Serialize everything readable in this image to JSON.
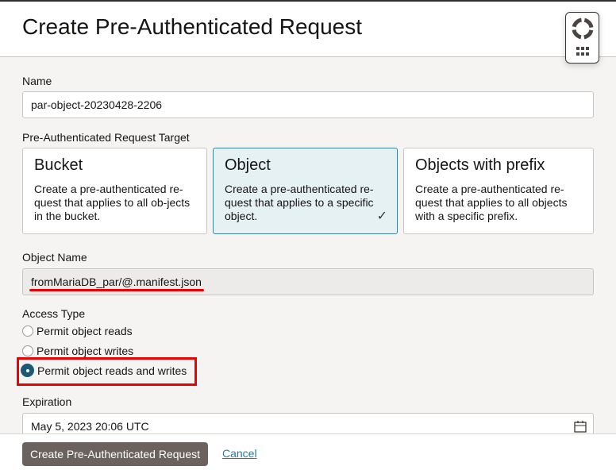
{
  "dialog": {
    "title": "Create Pre-Authenticated Request"
  },
  "name": {
    "label": "Name",
    "value": "par-object-20230428-2206"
  },
  "target": {
    "label": "Pre-Authenticated Request Target",
    "options": [
      {
        "title": "Bucket",
        "desc": "Create a pre-authenticated re-quest that applies to all ob-jects in the bucket.",
        "selected": false
      },
      {
        "title": "Object",
        "desc": "Create a pre-authenticated re-quest that applies to a specific object.",
        "selected": true
      },
      {
        "title": "Objects with prefix",
        "desc": "Create a pre-authenticated re-quest that applies to all objects with a specific prefix.",
        "selected": false
      }
    ]
  },
  "object_name": {
    "label": "Object Name",
    "value": "fromMariaDB_par/@.manifest.json"
  },
  "access": {
    "label": "Access Type",
    "options": [
      "Permit object reads",
      "Permit object writes",
      "Permit object reads and writes"
    ],
    "selected": 2
  },
  "expiration": {
    "label": "Expiration",
    "value": "May 5, 2023 20:06 UTC"
  },
  "footer": {
    "create": "Create Pre-Authenticated Request",
    "cancel": "Cancel"
  },
  "colors": {
    "accent": "#1b5a75",
    "highlight": "#e00000"
  }
}
